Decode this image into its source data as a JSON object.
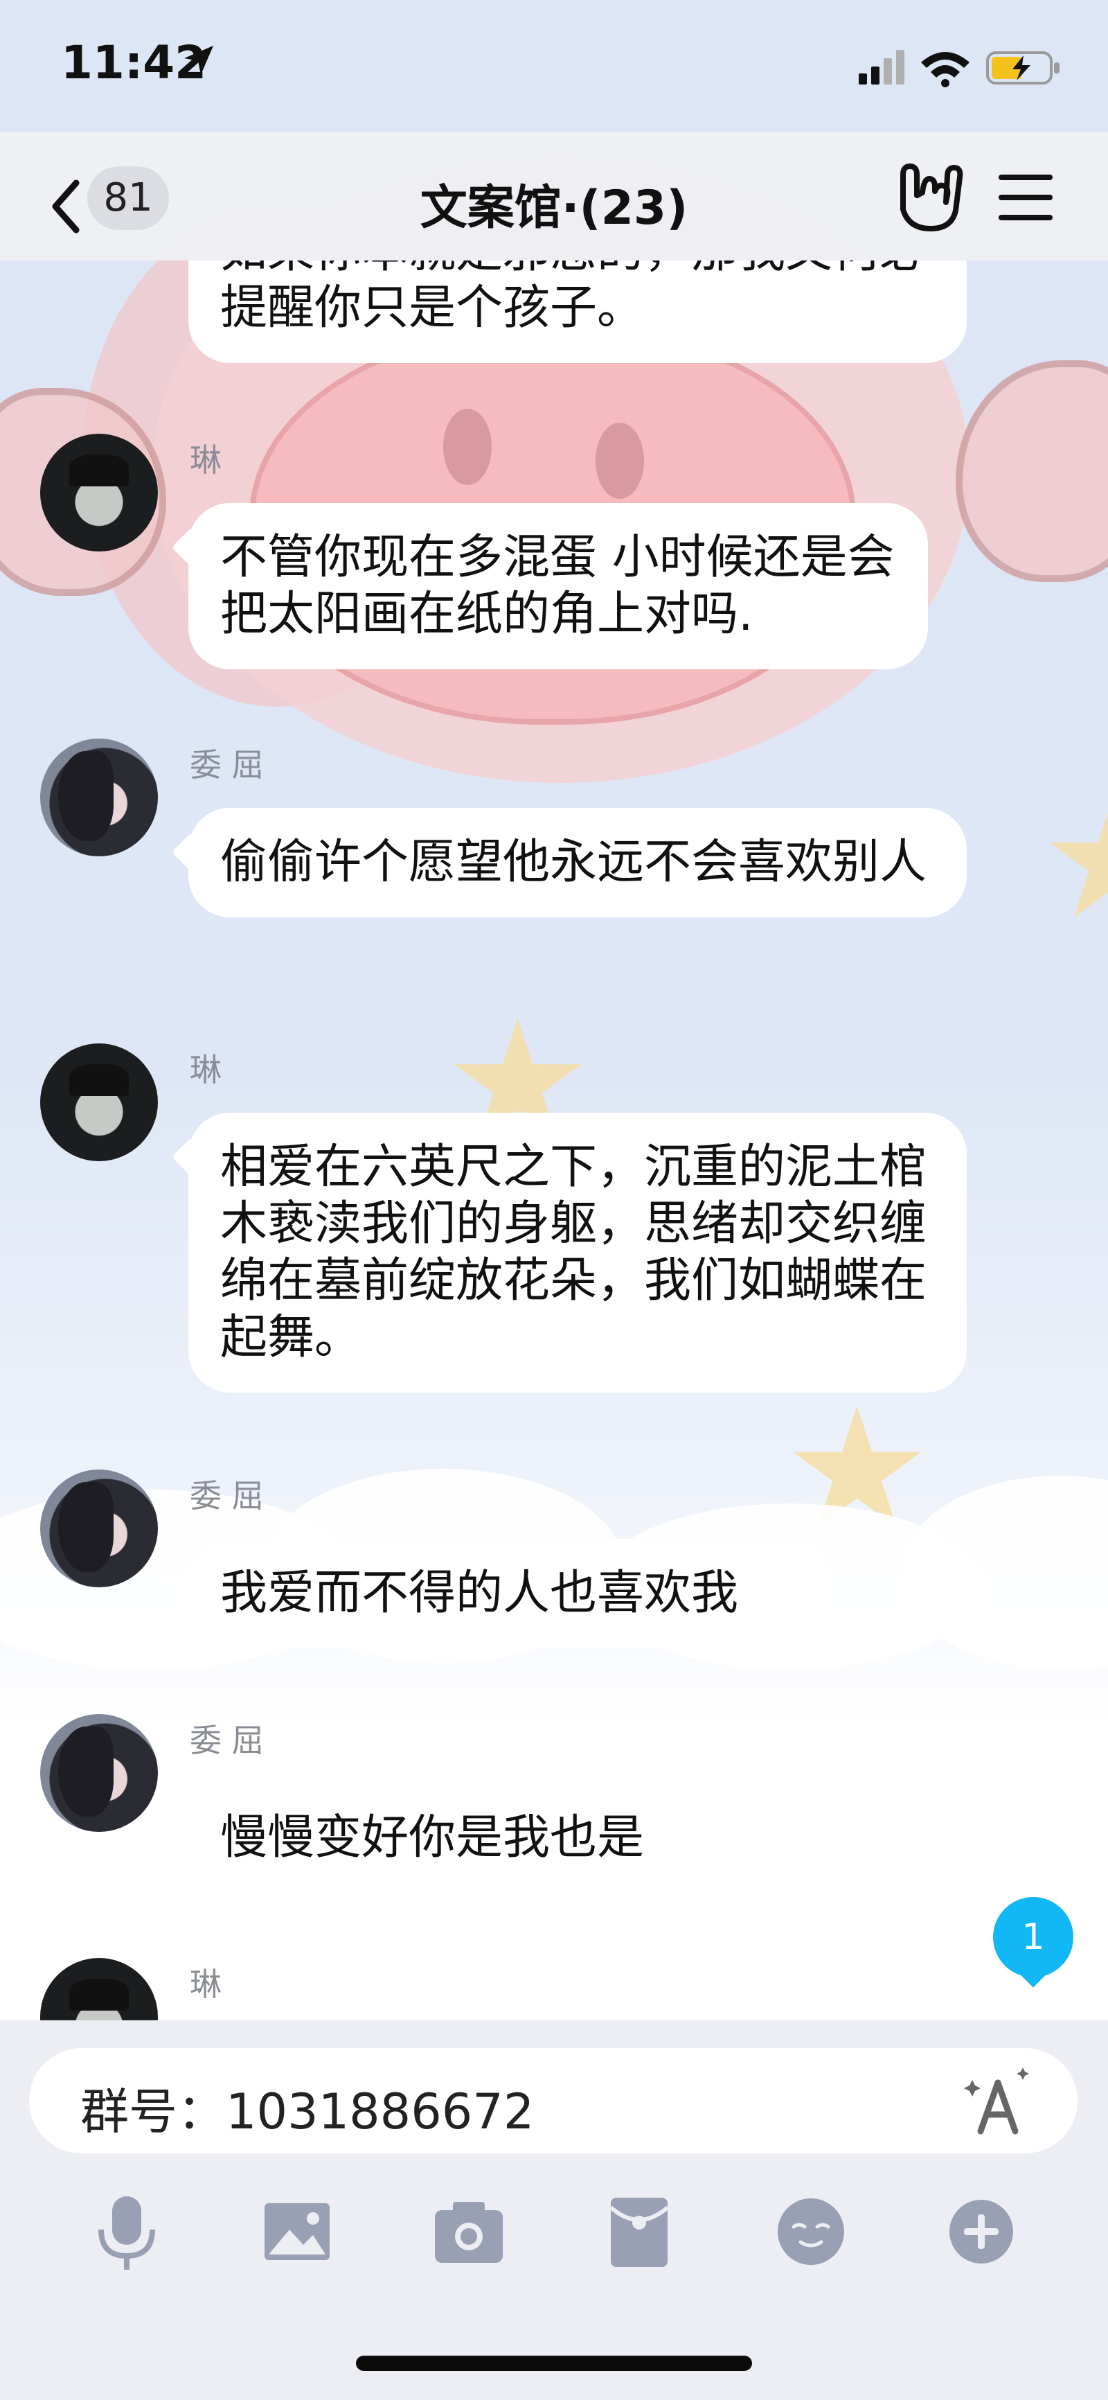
{
  "status_bar": {
    "time": "11:42"
  },
  "nav": {
    "unread_count": "81",
    "title": "文案馆·(23)"
  },
  "messages": [
    {
      "sender": "",
      "text": "如果你本就是邪恶的，那我又何必提醒你只是个孩子。"
    },
    {
      "sender": "琳",
      "text": "不管你现在多混蛋 小时候还是会把太阳画在纸的角上对吗."
    },
    {
      "sender": "委 屈",
      "text": "偷偷许个愿望他永远不会喜欢别人"
    },
    {
      "sender": "琳",
      "text": "相爱在六英尺之下，沉重的泥土棺木亵渎我们的身躯，思绪却交织缠绵在墓前绽放花朵，我们如蝴蝶在起舞。"
    },
    {
      "sender": "委 屈",
      "text": "我爱而不得的人也喜欢我"
    },
    {
      "sender": "委 屈",
      "text": "慢慢变好你是我也是"
    },
    {
      "sender": "琳",
      "text": ""
    }
  ],
  "new_message_badge": "1",
  "input": {
    "value": "群号：1031886672"
  },
  "toolbar": [
    "microphone-icon",
    "image-icon",
    "camera-icon",
    "red-packet-icon",
    "emoji-icon",
    "plus-icon"
  ],
  "colors": {
    "unread_badge": "#12b7f5",
    "toolbar_icon": "#9aa0b4",
    "bubble": "#ffffff"
  }
}
